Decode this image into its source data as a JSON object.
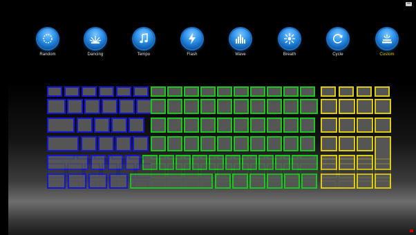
{
  "modes": [
    {
      "id": "random",
      "label": "Random",
      "icon": "random-icon"
    },
    {
      "id": "dancing",
      "label": "Dancing",
      "icon": "dancing-icon"
    },
    {
      "id": "tempo",
      "label": "Tempo",
      "icon": "music-note-icon"
    },
    {
      "id": "flash",
      "label": "Flash",
      "icon": "lightning-icon"
    },
    {
      "id": "wave",
      "label": "Wave",
      "icon": "equalizer-icon"
    },
    {
      "id": "breath",
      "label": "Breath",
      "icon": "burst-icon"
    },
    {
      "id": "cycle",
      "label": "Cycle",
      "icon": "cycle-icon"
    },
    {
      "id": "custom",
      "label": "Custom",
      "icon": "custom-icon",
      "active": true
    }
  ],
  "keyboard": {
    "zones": [
      {
        "name": "left",
        "color": "#1515d6"
      },
      {
        "name": "center",
        "color": "#18c81a"
      },
      {
        "name": "right",
        "color": "#dccb0e"
      }
    ],
    "key_color": "#555555"
  }
}
